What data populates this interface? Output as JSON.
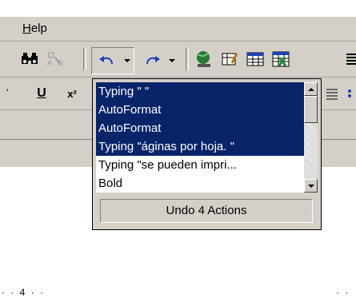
{
  "menu": {
    "items": [
      {
        "label": "Help"
      }
    ]
  },
  "toolbar": {
    "icons": [
      "binoculars-icon",
      "format-painter-icon",
      "undo-icon",
      "redo-icon",
      "web-icon",
      "tables-borders-icon",
      "insert-table-icon",
      "insert-excel-icon",
      "columns-icon"
    ]
  },
  "format_toolbar": {
    "underline_label": "U",
    "superscript_label": "x²"
  },
  "ruler": {
    "marks": "· · 4 · ·",
    "marks_right": "· ·"
  },
  "undo_list": {
    "items": [
      {
        "label": "Typing \" \"",
        "selected": true
      },
      {
        "label": "AutoFormat",
        "selected": true
      },
      {
        "label": "AutoFormat",
        "selected": true
      },
      {
        "label": "Typing \"áginas por hoja. \"",
        "selected": true
      },
      {
        "label": "Typing \"se pueden impri...",
        "selected": false
      },
      {
        "label": "Bold",
        "selected": false
      }
    ],
    "status": "Undo 4 Actions"
  },
  "colors": {
    "selection": "#0a246a",
    "face": "#d4d0c8"
  }
}
